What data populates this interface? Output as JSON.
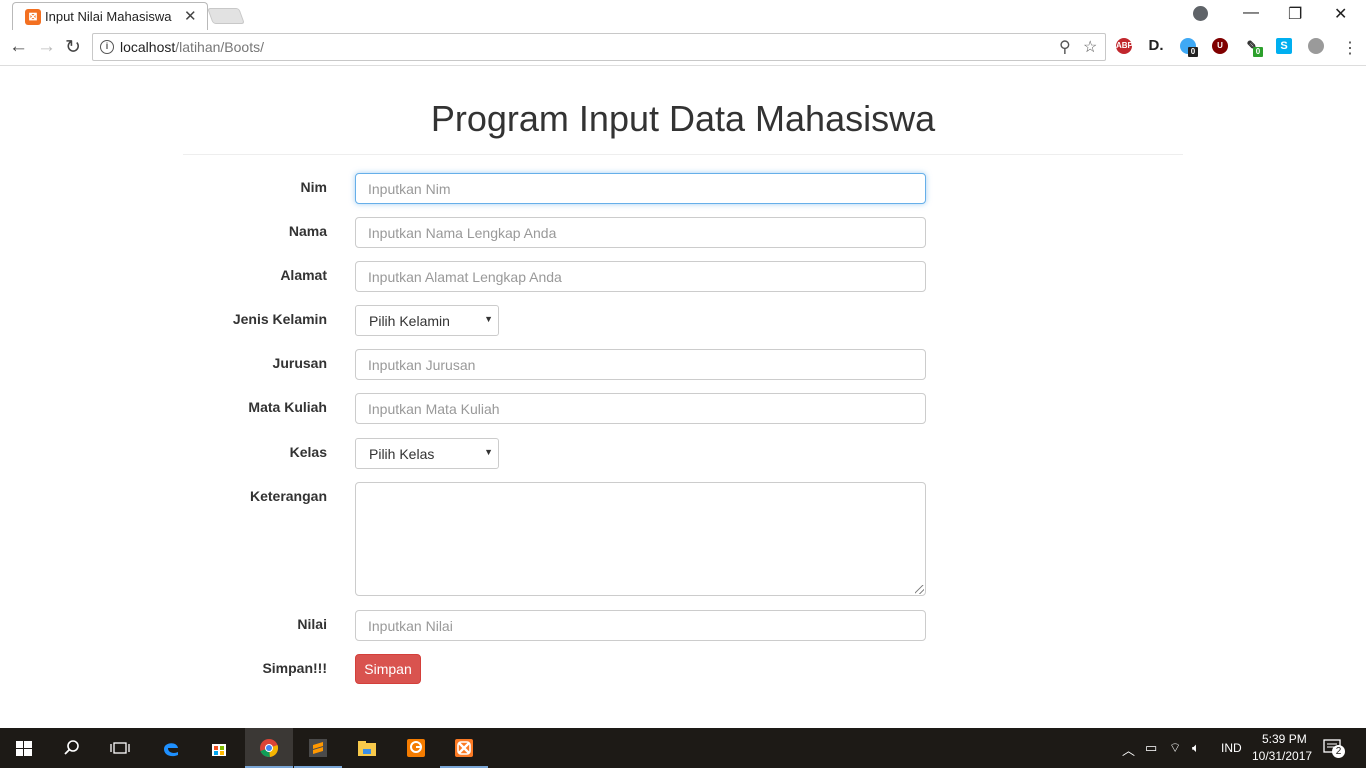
{
  "browser": {
    "tab_title": "Input Nilai Mahasiswa",
    "url_host": "localhost",
    "url_path": "/latihan/Boots/",
    "extensions": [
      {
        "name": "abp",
        "label": "ABP",
        "color": "#c1272d"
      },
      {
        "name": "d-ext",
        "label": "D.",
        "color": "#222222"
      },
      {
        "name": "ghostery",
        "label": "",
        "color": "#3fa9f5",
        "badge": "0"
      },
      {
        "name": "ublock",
        "label": "U",
        "color": "#800000"
      },
      {
        "name": "ext-green",
        "label": "",
        "color": "#333333",
        "badge": "0"
      },
      {
        "name": "skype",
        "label": "S",
        "color": "#00aff0"
      },
      {
        "name": "ext-gray",
        "label": "",
        "color": "#9a9a9a"
      }
    ]
  },
  "page": {
    "title": "Program Input Data Mahasiswa"
  },
  "form": {
    "nim": {
      "label": "Nim",
      "placeholder": "Inputkan Nim"
    },
    "nama": {
      "label": "Nama",
      "placeholder": "Inputkan Nama Lengkap Anda"
    },
    "alamat": {
      "label": "Alamat",
      "placeholder": "Inputkan Alamat Lengkap Anda"
    },
    "jenis_kelamin": {
      "label": "Jenis Kelamin",
      "selected": "Pilih Kelamin"
    },
    "jurusan": {
      "label": "Jurusan",
      "placeholder": "Inputkan Jurusan"
    },
    "mata_kuliah": {
      "label": "Mata Kuliah",
      "placeholder": "Inputkan Mata Kuliah"
    },
    "kelas": {
      "label": "Kelas",
      "selected": "Pilih Kelas"
    },
    "keterangan": {
      "label": "Keterangan"
    },
    "nilai": {
      "label": "Nilai",
      "placeholder": "Inputkan Nilai"
    },
    "simpan": {
      "label": "Simpan!!!",
      "button": "Simpan"
    }
  },
  "taskbar": {
    "language": "IND",
    "time": "5:39 PM",
    "date": "10/31/2017",
    "notification_count": "2",
    "accent_color": "#7aa6d6"
  }
}
